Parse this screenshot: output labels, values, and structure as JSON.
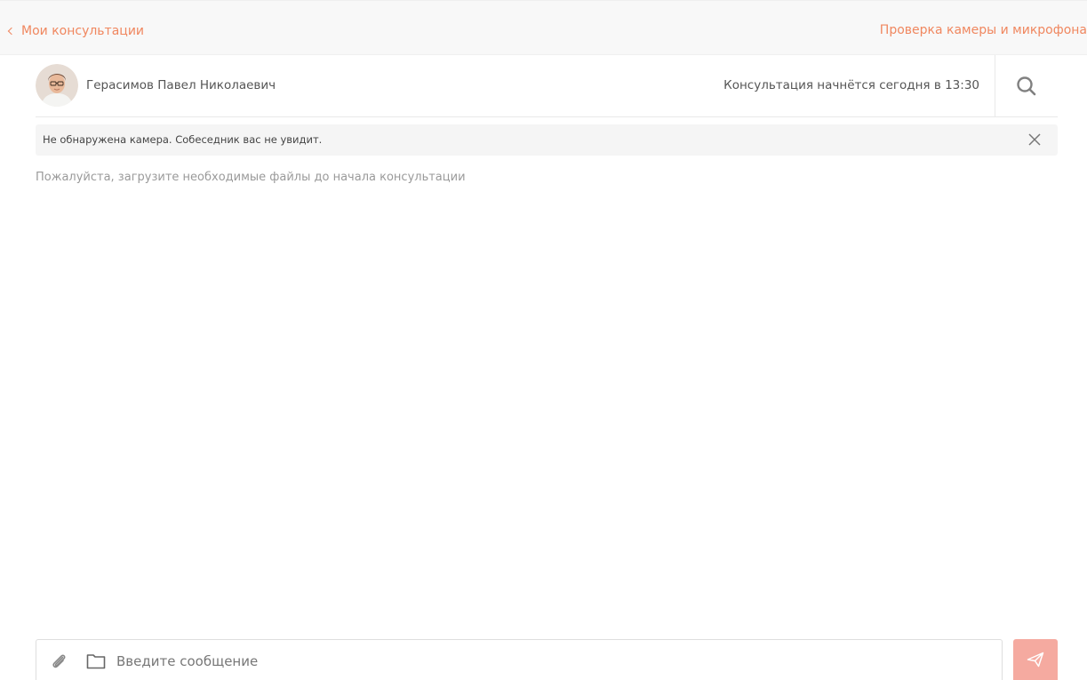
{
  "nav": {
    "back_label": "Мои консультации",
    "check_label": "Проверка камеры и микрофона"
  },
  "header": {
    "doctor_name": "Герасимов Павел Николаевич",
    "consultation_time": "Консультация начнётся сегодня в 13:30"
  },
  "warning": {
    "text": "Не обнаружена камера. Собеседник вас не увидит."
  },
  "hint": "Пожалуйста, загрузите необходимые файлы до начала консультации",
  "composer": {
    "placeholder": "Введите сообщение"
  },
  "colors": {
    "accent": "#f0875f",
    "send_button": "#f5aaa0"
  },
  "icons": {
    "back": "chevron-left-icon",
    "search": "search-icon",
    "close": "close-icon",
    "attach": "paperclip-icon",
    "folder": "folder-icon",
    "send": "send-icon"
  }
}
